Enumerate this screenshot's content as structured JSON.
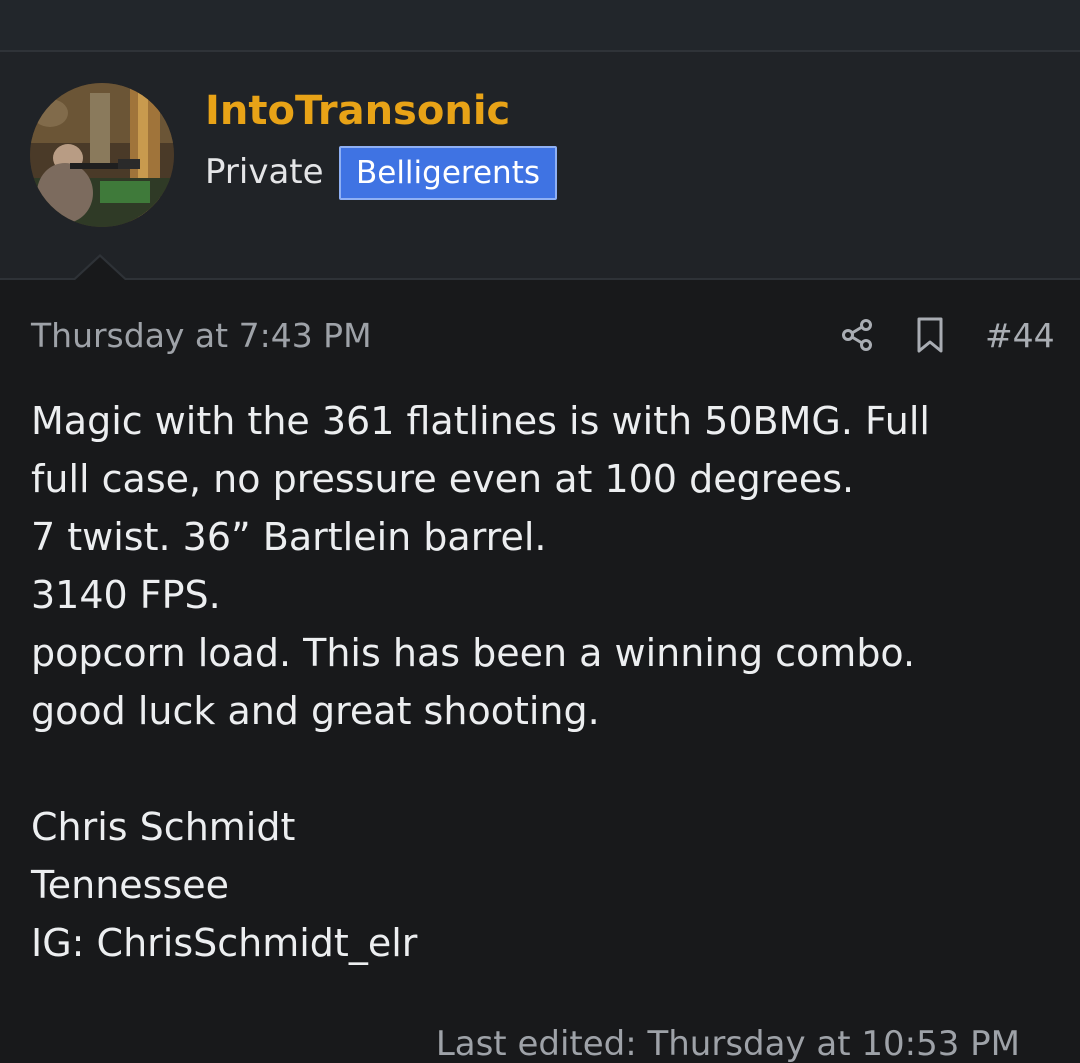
{
  "user": {
    "name": "IntoTransonic",
    "title": "Private",
    "banner": "Belligerents",
    "name_color": "#e8a317",
    "banner_color": "#3f73e3"
  },
  "post": {
    "date": "Thursday at 7:43 PM",
    "number": "#44",
    "share_icon": "share-icon",
    "bookmark_icon": "bookmark-icon",
    "lines": [
      "Magic with the 361 flatlines is with 50BMG. Full",
      "full case, no pressure even at 100 degrees.",
      "7 twist. 36” Bartlein barrel.",
      "3140 FPS.",
      "popcorn load. This has been a winning combo.",
      "good luck and great shooting."
    ],
    "signature": [
      "Chris Schmidt",
      "Tennessee",
      "IG: ChrisSchmidt_elr"
    ],
    "last_edited": "Last edited: Thursday at 10:53 PM"
  }
}
